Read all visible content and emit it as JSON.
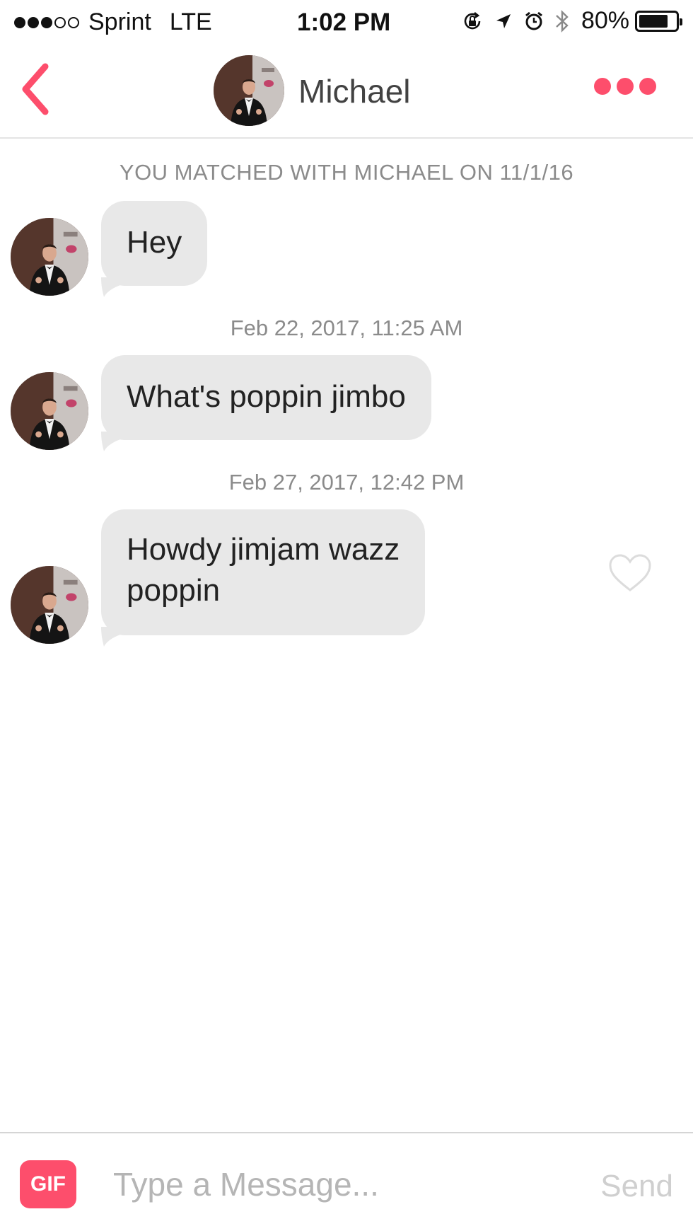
{
  "status_bar": {
    "carrier": "Sprint",
    "network": "LTE",
    "time": "1:02 PM",
    "battery_percent": "80%",
    "battery_level": 0.8,
    "signal_bars_filled": 3,
    "signal_bars_total": 5,
    "icons": [
      "rotation-lock-icon",
      "location-arrow-icon",
      "alarm-clock-icon",
      "bluetooth-icon",
      "battery-icon"
    ]
  },
  "header": {
    "name": "Michael",
    "back_icon": "chevron-left-icon",
    "more_icon": "more-dots-icon"
  },
  "conversation": {
    "match_banner": "YOU MATCHED WITH MICHAEL ON 11/1/16",
    "messages": [
      {
        "text": "Hey"
      },
      {
        "timestamp": "Feb 22, 2017, 11:25 AM",
        "text": "What's poppin jimbo"
      },
      {
        "timestamp": "Feb 27, 2017, 12:42 PM",
        "text_lines": [
          "Howdy jimjam wazz",
          "poppin"
        ],
        "liked": false
      }
    ]
  },
  "composer": {
    "gif_label": "GIF",
    "placeholder": "Type a Message...",
    "value": "",
    "send_label": "Send"
  },
  "colors": {
    "accent": "#fd4e6c",
    "bubble": "#e8e8e8",
    "meta_text": "#8b8b8b",
    "send_disabled": "#cfcfcf"
  }
}
